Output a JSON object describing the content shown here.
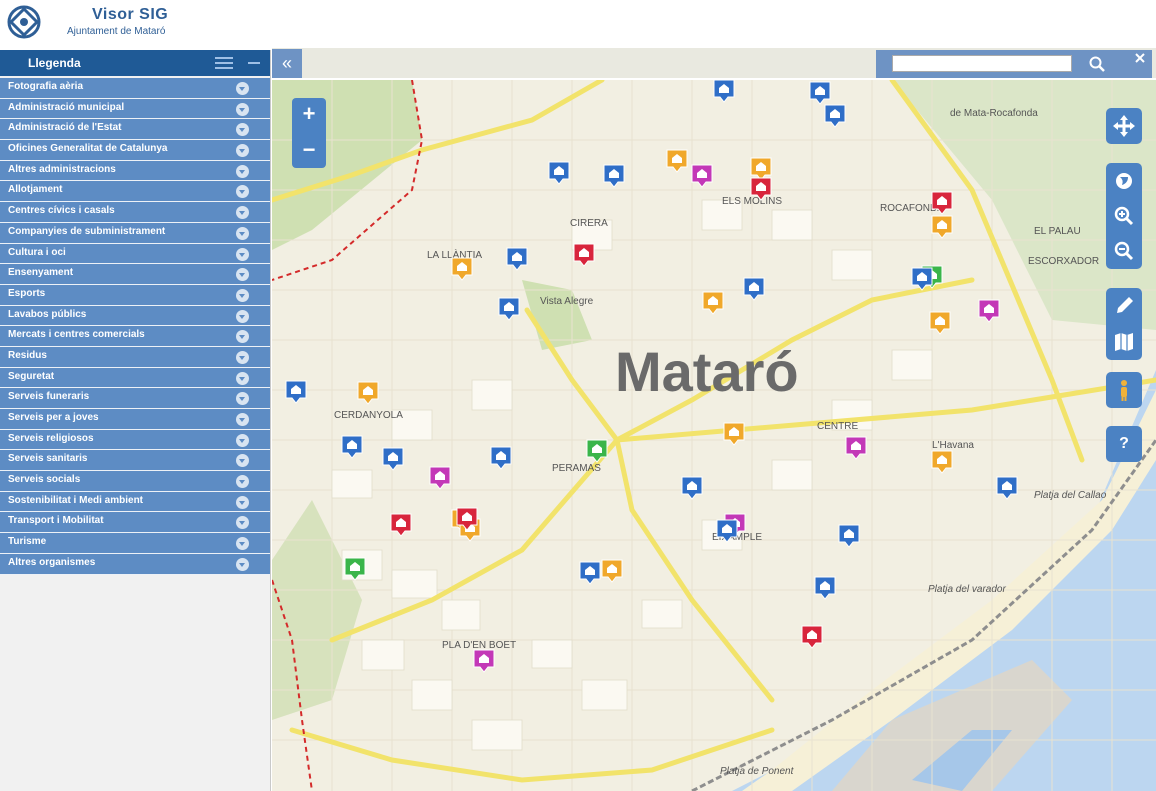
{
  "header": {
    "title": "Visor SIG",
    "subtitle": "Ajuntament de Mataró"
  },
  "legend": {
    "title": "Llegenda",
    "items": [
      "Fotografia aèria",
      "Administració municipal",
      "Administració de l'Estat",
      "Oficines Generalitat de Catalunya",
      "Altres administracions",
      "Allotjament",
      "Centres cívics i casals",
      "Companyies de subministrament",
      "Cultura i oci",
      "Ensenyament",
      "Esports",
      "Lavabos públics",
      "Mercats i centres comercials",
      "Residus",
      "Seguretat",
      "Serveis funeraris",
      "Serveis per a joves",
      "Serveis religiosos",
      "Serveis sanitaris",
      "Serveis socials",
      "Sostenibilitat i Medi ambient",
      "Transport i Mobilitat",
      "Turisme",
      "Altres organismes"
    ]
  },
  "toolbar": {
    "collapse_label": "«",
    "search_placeholder": ""
  },
  "map": {
    "city_label": "Mataró",
    "zoom_in": "+",
    "zoom_out": "−",
    "help_label": "?",
    "place_labels": [
      "EL PALAU",
      "ESCORXADOR",
      "de Mata-Rocafonda",
      "ROCAFONDA",
      "ELS MOLINS",
      "CIRERA",
      "LA LLÀNTIA",
      "Vista Alegre",
      "CERDANYOLA",
      "PERAMAS",
      "CENTRE",
      "L'Havana",
      "EIXAMPLE",
      "PLA D'EN BOET",
      "Platja del Callao",
      "Platja del varador",
      "Platja de Ponent"
    ],
    "colors": {
      "blue": "#2f6ec7",
      "orange": "#f0a82b",
      "magenta": "#c338b7",
      "red": "#d8253c",
      "green": "#3ab54a",
      "land": "#f2efe2",
      "sea": "#bcd6f0",
      "park": "#cfe0b2",
      "road": "#f7ea7b"
    }
  }
}
